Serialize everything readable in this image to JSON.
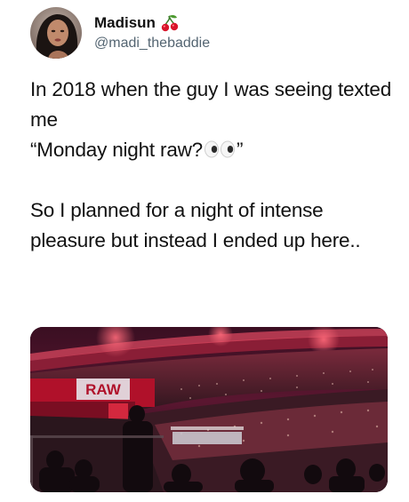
{
  "tweet": {
    "author": {
      "display_name": "Madisun",
      "handle": "@madi_thebaddie",
      "name_emoji": "cherry-icon",
      "avatar": "avatar-photo"
    },
    "text": {
      "line1": "In 2018 when the guy I was seeing texted me",
      "quote_prefix": "“Monday night raw?",
      "quote_emoji": "eyes-icon",
      "quote_suffix": "”",
      "paragraph2": "So I planned for a night of intense pleasure but instead I ended up here.."
    },
    "media": {
      "type": "photo",
      "arena_sign": "RAW",
      "description_icon": "wrestling-arena-photo"
    }
  },
  "colors": {
    "text_primary": "#111111",
    "handle_gray": "#536471",
    "arena_red": "#c4162a",
    "background": "#ffffff"
  }
}
